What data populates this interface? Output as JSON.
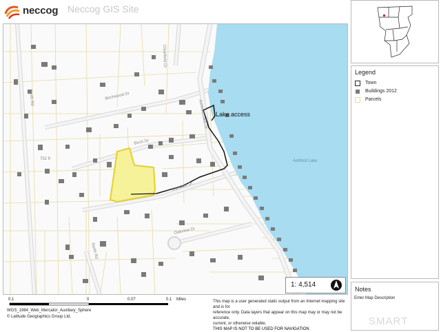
{
  "header": {
    "logo_text": "neccog",
    "site_title": "Neccog GIS Site"
  },
  "map": {
    "water_color": "#a7dcf1",
    "parcel_line_color": "#e8d9a0",
    "road_color": "#c9c9c9",
    "building_color": "#7a7a7a",
    "highlight_fill": "#f5f29a",
    "highlight_stroke": "#e3cf2e",
    "labels": {
      "lake_access": "Lake access",
      "ashford_lake": "Ashford Lake",
      "north_rd": "North Rd",
      "north_rd_lower": "North Rd",
      "birchwood_dr": "Birchwood Dr",
      "ashford_lake_dr": "Ashford Lake Dr",
      "birch_dr": "Birch Dr",
      "wyndale_dr": "Wyndale Dr",
      "oakview_dr": "Oakview Dr",
      "clearfield_dr": "Clearfield Dr",
      "elevation": "752 ft"
    }
  },
  "scale_box": {
    "text": "1: 4,514",
    "icon": "north-arrow-icon"
  },
  "footer": {
    "scale_ticks": [
      "0.1",
      "0",
      "0.07",
      "0.1"
    ],
    "scale_unit": "Miles",
    "projection": "WGS_1984_Web_Mercator_Auxiliary_Sphere",
    "attribution": "© Latitude Geographics Group Ltd.",
    "disclaimer_1": "This map is a user generated static output from an Internet mapping site and is for",
    "disclaimer_2": "reference only. Data layers that appear on this map may or may not be accurate,",
    "disclaimer_3": "current, or otherwise reliable.",
    "disclaimer_4": "THIS MAP IS NOT TO BE USED FOR NAVIGATION"
  },
  "legend": {
    "title": "Legend",
    "items": [
      {
        "label": "Town",
        "icon": "town-outline-swatch",
        "color": "#222222"
      },
      {
        "label": "Buildings 2012",
        "icon": "building-swatch",
        "color": "#7a7a7a"
      },
      {
        "label": "Parcels",
        "icon": "parcel-swatch",
        "color": "#e8d9a0"
      }
    ]
  },
  "notes": {
    "title": "Notes",
    "text": "Enter Map Description"
  },
  "watermark": "SMART"
}
